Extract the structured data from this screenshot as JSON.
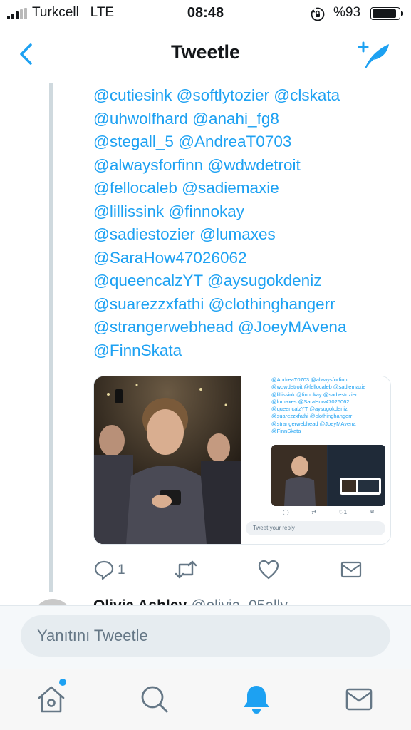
{
  "status_bar": {
    "carrier": "Turkcell",
    "network": "LTE",
    "time": "08:48",
    "battery_percent": "%93",
    "battery_level": 0.93
  },
  "nav": {
    "title": "Tweetle",
    "back_icon": "chevron-left-icon",
    "compose_icon": "compose-tweet-icon"
  },
  "tweet": {
    "mention_lines": [
      "@cutiesink @softlytozier @clskata",
      "@uhwolfhard @anahi_fg8",
      "@stegall_5 @AndreaT0703",
      "@alwaysforfinn @wdwdetroit",
      "@fellocaleb @sadiemaxie",
      "@lillissink @finnokay",
      "@sadiestozier @lumaxes",
      "@SaraHow47026062",
      "@queencalzYT @aysugokdeniz",
      "@suarezzxfathi @clothinghangerr",
      "@strangerwebhead @JoeyMAvena",
      "@FinnSkata"
    ],
    "media": {
      "preview_lines": [
        "@AndreaT0703 @alwaysforfinn",
        "@wdwdetroit @fellocaleb @sadiemaxie",
        "@lillissink @finnokay @sadiestozier",
        "@lumaxes @SaraHow47026062",
        "@queencalzYT @aysugokdeniz",
        "@suarezzxfathi @clothinghangerr",
        "@strangerwebhead @JoeyMAvena",
        "@FinnSkata"
      ],
      "preview_like_count": "1",
      "preview_reply_placeholder": "Tweet your reply"
    },
    "actions": {
      "reply_count": "1"
    }
  },
  "next_tweet": {
    "name": "Olivia Ashley",
    "handle": "@olivia_05ally"
  },
  "reply_bar": {
    "placeholder": "Yanıtını Tweetle"
  },
  "tab_bar": {
    "items": [
      "home-icon",
      "search-icon",
      "notifications-icon",
      "messages-icon"
    ],
    "active": "notifications-icon"
  },
  "colors": {
    "accent": "#1da1f2",
    "text": "#14171a",
    "secondary": "#657786"
  }
}
